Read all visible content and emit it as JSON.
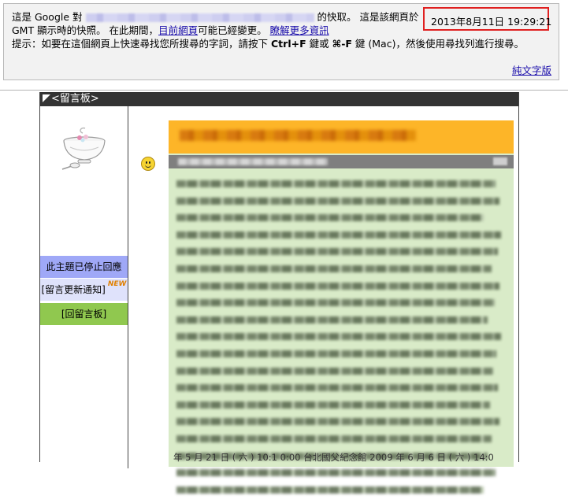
{
  "cache_banner": {
    "prefix": "這是 Google 對",
    "suffix": "的快取。 這是該網頁於",
    "date": "2013年8月11日 19:29:21",
    "line2_a": "GMT 顯示時的快照。 在此期間，",
    "current_page_link": "目前網頁",
    "line2_b": "可能已經變更。",
    "learn_more_link": "瞭解更多資訊",
    "tip_a": "提示：如要在這個網頁上快速尋找您所搜尋的字詞，請按下",
    "key_ctrl_f": "Ctrl+F",
    "tip_b": "鍵或",
    "key_cmd_f": "⌘-F",
    "tip_c": "鍵 (Mac)，然後使用尋找列進行搜尋。",
    "text_only_link": "純文字版"
  },
  "guestbook": {
    "title": "<留言板>",
    "sidebar": {
      "stopped": "此主題已停止回應",
      "notify": "[留言更新通知]",
      "new_badge": "NEW",
      "back": "[回留言板]"
    },
    "footer_partial": "年 5 月 21 日 ( 六 ) 10:1 0:00 台北國父紀念館 2009 年 6 月 6 日 ( 六 ) 14:0"
  },
  "colors": {
    "accent_red": "#e02020",
    "link": "#1a0dab",
    "post_title_bar": "#fdb528",
    "post_body": "#d9ebc8",
    "sidebar_stopped": "#9fa8f7",
    "sidebar_back": "#90c84f"
  },
  "icons": [
    "bowl-icon",
    "smiley-icon"
  ]
}
